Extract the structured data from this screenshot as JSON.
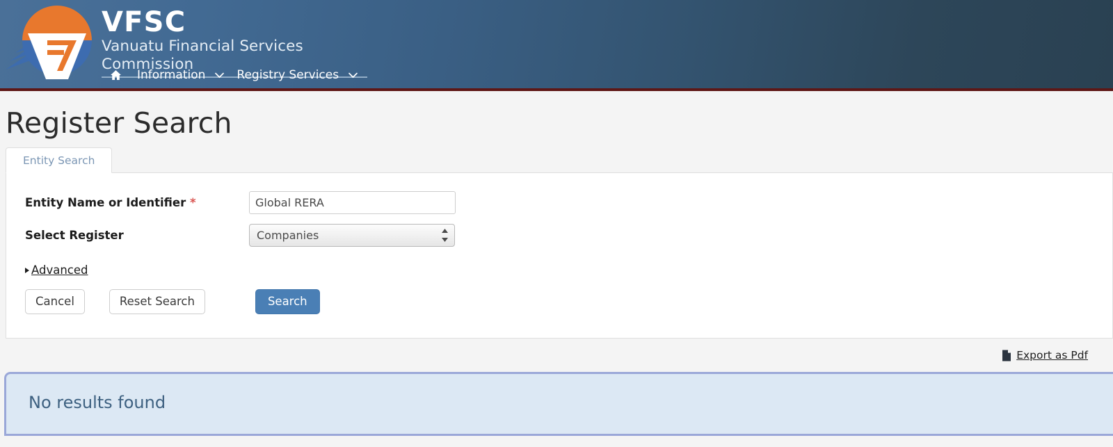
{
  "header": {
    "logo_icon": "vfsc-logo-icon",
    "brand_acronym": "VFSC",
    "brand_name": "Vanuatu Financial Services Commission",
    "nav": {
      "home_icon": "home-icon",
      "items": [
        {
          "label": "Information",
          "caret_icon": "chevron-down-icon"
        },
        {
          "label": "Registry Services",
          "caret_icon": "chevron-down-icon"
        }
      ]
    }
  },
  "page": {
    "title": "Register Search"
  },
  "tabs": [
    {
      "label": "Entity Search",
      "active": true
    }
  ],
  "form": {
    "entity_name": {
      "label": "Entity Name or Identifier",
      "required_marker": "*",
      "value": "Global RERA",
      "placeholder": ""
    },
    "select_register": {
      "label": "Select Register",
      "value": "Companies",
      "options": [
        "Companies"
      ],
      "stepper_icon": "stepper-updown-icon"
    },
    "advanced": {
      "label": "Advanced",
      "disclosure_icon": "disclosure-triangle-right-icon"
    },
    "buttons": {
      "cancel": "Cancel",
      "reset": "Reset Search",
      "search": "Search"
    }
  },
  "export": {
    "label": "Export as Pdf",
    "icon": "pdf-file-icon"
  },
  "results": {
    "message": "No results found"
  },
  "colors": {
    "header_gradient_start": "#4a7098",
    "header_gradient_end": "#2a4152",
    "header_bottom_rule": "#5e1716",
    "logo_orange": "#e8782d",
    "logo_blue": "#3d6cb0",
    "required_star": "#d9534f",
    "tab_label": "#7b96b4",
    "primary_button": "#4a7fb5",
    "alert_background": "#dce8f4",
    "alert_border": "#9aa7d8",
    "alert_text": "#3d6080",
    "page_background": "#f4f4f4"
  }
}
